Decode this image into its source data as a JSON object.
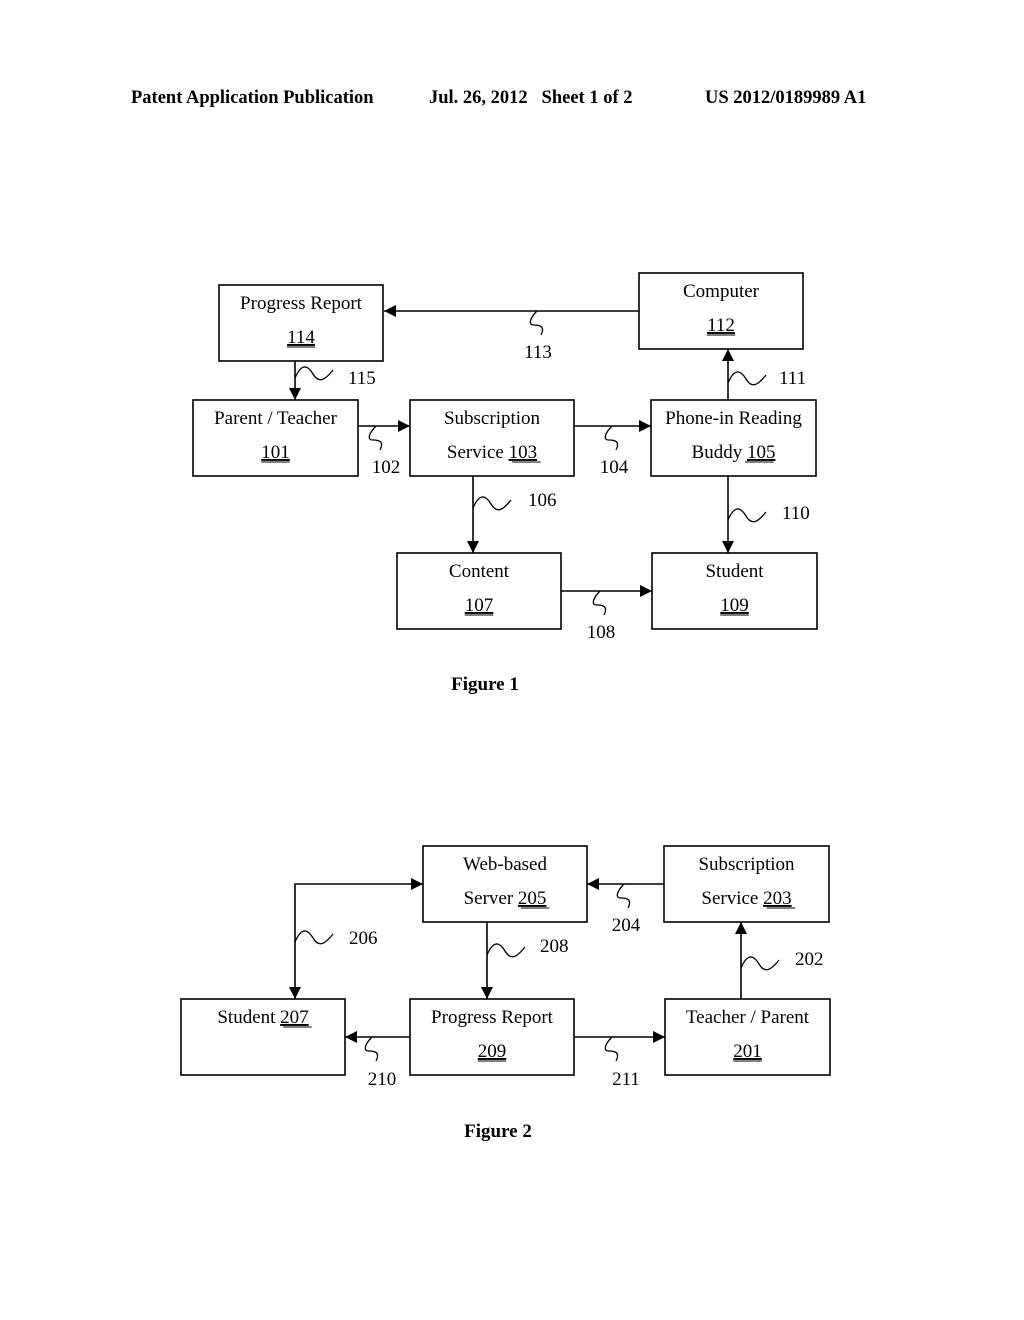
{
  "header": {
    "publication": "Patent Application Publication",
    "date_sheet": "Jul. 26, 2012   Sheet 1 of 2",
    "number": "US 2012/0189989 A1"
  },
  "figures": [
    {
      "id": "figure-1",
      "caption": "Figure 1",
      "nodes": [
        {
          "id": "n114",
          "line1": "Progress Report",
          "line2_prefix": "",
          "ref": "114"
        },
        {
          "id": "n112",
          "line1": "Computer",
          "line2_prefix": "",
          "ref": "112"
        },
        {
          "id": "n101",
          "line1": "Parent / Teacher",
          "line2_prefix": "",
          "ref": "101"
        },
        {
          "id": "n103",
          "line1": "Subscription",
          "line2_prefix": "Service ",
          "ref": "103"
        },
        {
          "id": "n105",
          "line1": "Phone-in Reading",
          "line2_prefix": "Buddy ",
          "ref": "105"
        },
        {
          "id": "n107",
          "line1": "Content",
          "line2_prefix": "",
          "ref": "107"
        },
        {
          "id": "n109",
          "line1": "Student",
          "line2_prefix": "",
          "ref": "109"
        }
      ],
      "edges": [
        {
          "from": "n112",
          "to": "n114",
          "label": "113"
        },
        {
          "from": "n114",
          "to": "n101",
          "label": "115"
        },
        {
          "from": "n101",
          "to": "n103",
          "label": "102"
        },
        {
          "from": "n103",
          "to": "n105",
          "label": "104"
        },
        {
          "from": "n105",
          "to": "n112",
          "label": "111"
        },
        {
          "from": "n103",
          "to": "n107",
          "label": "106"
        },
        {
          "from": "n105",
          "to": "n109",
          "label": "110"
        },
        {
          "from": "n107",
          "to": "n109",
          "label": "108"
        }
      ]
    },
    {
      "id": "figure-2",
      "caption": "Figure 2",
      "nodes": [
        {
          "id": "n205",
          "line1": "Web-based",
          "line2_prefix": "Server ",
          "ref": "205"
        },
        {
          "id": "n203",
          "line1": "Subscription",
          "line2_prefix": "Service ",
          "ref": "203"
        },
        {
          "id": "n207",
          "line1": "Student ",
          "line2_prefix": "",
          "ref": "207",
          "ref_inline": true
        },
        {
          "id": "n209",
          "line1": "Progress Report",
          "line2_prefix": "",
          "ref": "209"
        },
        {
          "id": "n201",
          "line1": "Teacher / Parent",
          "line2_prefix": "",
          "ref": "201"
        }
      ],
      "edges": [
        {
          "from": "n203",
          "to": "n205",
          "label": "204"
        },
        {
          "from": "n205",
          "to": "n207",
          "label": "206",
          "bidirectional": true
        },
        {
          "from": "n205",
          "to": "n209",
          "label": "208"
        },
        {
          "from": "n201",
          "to": "n203",
          "label": "202"
        },
        {
          "from": "n209",
          "to": "n207",
          "label": "210"
        },
        {
          "from": "n209",
          "to": "n201",
          "label": "211"
        }
      ]
    }
  ]
}
